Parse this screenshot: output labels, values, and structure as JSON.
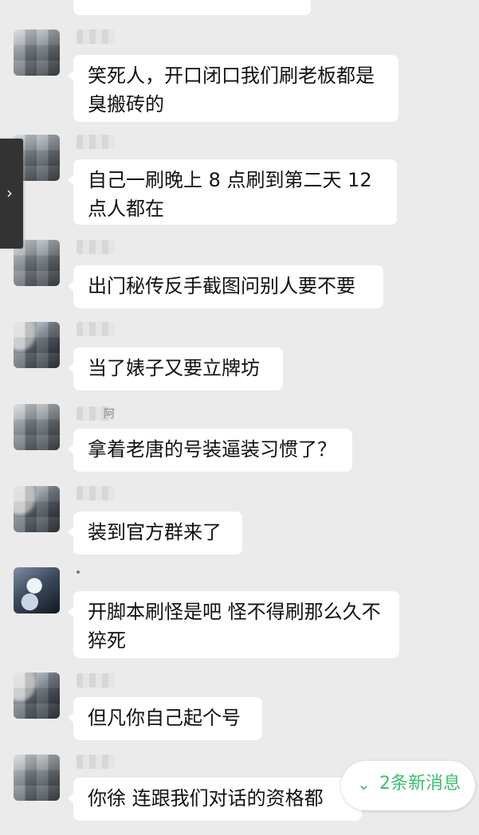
{
  "new_messages": {
    "label": "2条新消息",
    "icon": "double-chevron-down-icon",
    "accent": "#3cbf6d"
  },
  "sidebar_handle": {
    "icon": "chevron-right-icon"
  },
  "messages": [
    {
      "text": "笑死人，开口闭口我们刷老板都是臭搬砖的",
      "avatar": "blurred-avatar",
      "name_visible": ""
    },
    {
      "text": "自己一刷晚上 8 点刷到第二天 12 点人都在",
      "avatar": "blurred-avatar",
      "name_visible": ""
    },
    {
      "text": "出门秘传反手截图问别人要不要",
      "avatar": "blurred-avatar",
      "name_visible": ""
    },
    {
      "text": "当了婊子又要立牌坊",
      "avatar": "blurred-avatar",
      "name_visible": ""
    },
    {
      "text": "拿着老唐的号装逼装习惯了？",
      "avatar": "blurred-avatar",
      "name_visible": "阿"
    },
    {
      "text": "装到官方群来了",
      "avatar": "blurred-avatar",
      "name_visible": ""
    },
    {
      "text": "开脚本刷怪是吧 怪不得刷那么久不猝死",
      "avatar": "anime-avatar",
      "name_visible": ""
    },
    {
      "text": "但凡你自己起个号",
      "avatar": "blurred-avatar",
      "name_visible": ""
    },
    {
      "text": "你徐 连跟我们对话的资格都",
      "avatar": "blurred-avatar",
      "name_visible": ""
    }
  ]
}
